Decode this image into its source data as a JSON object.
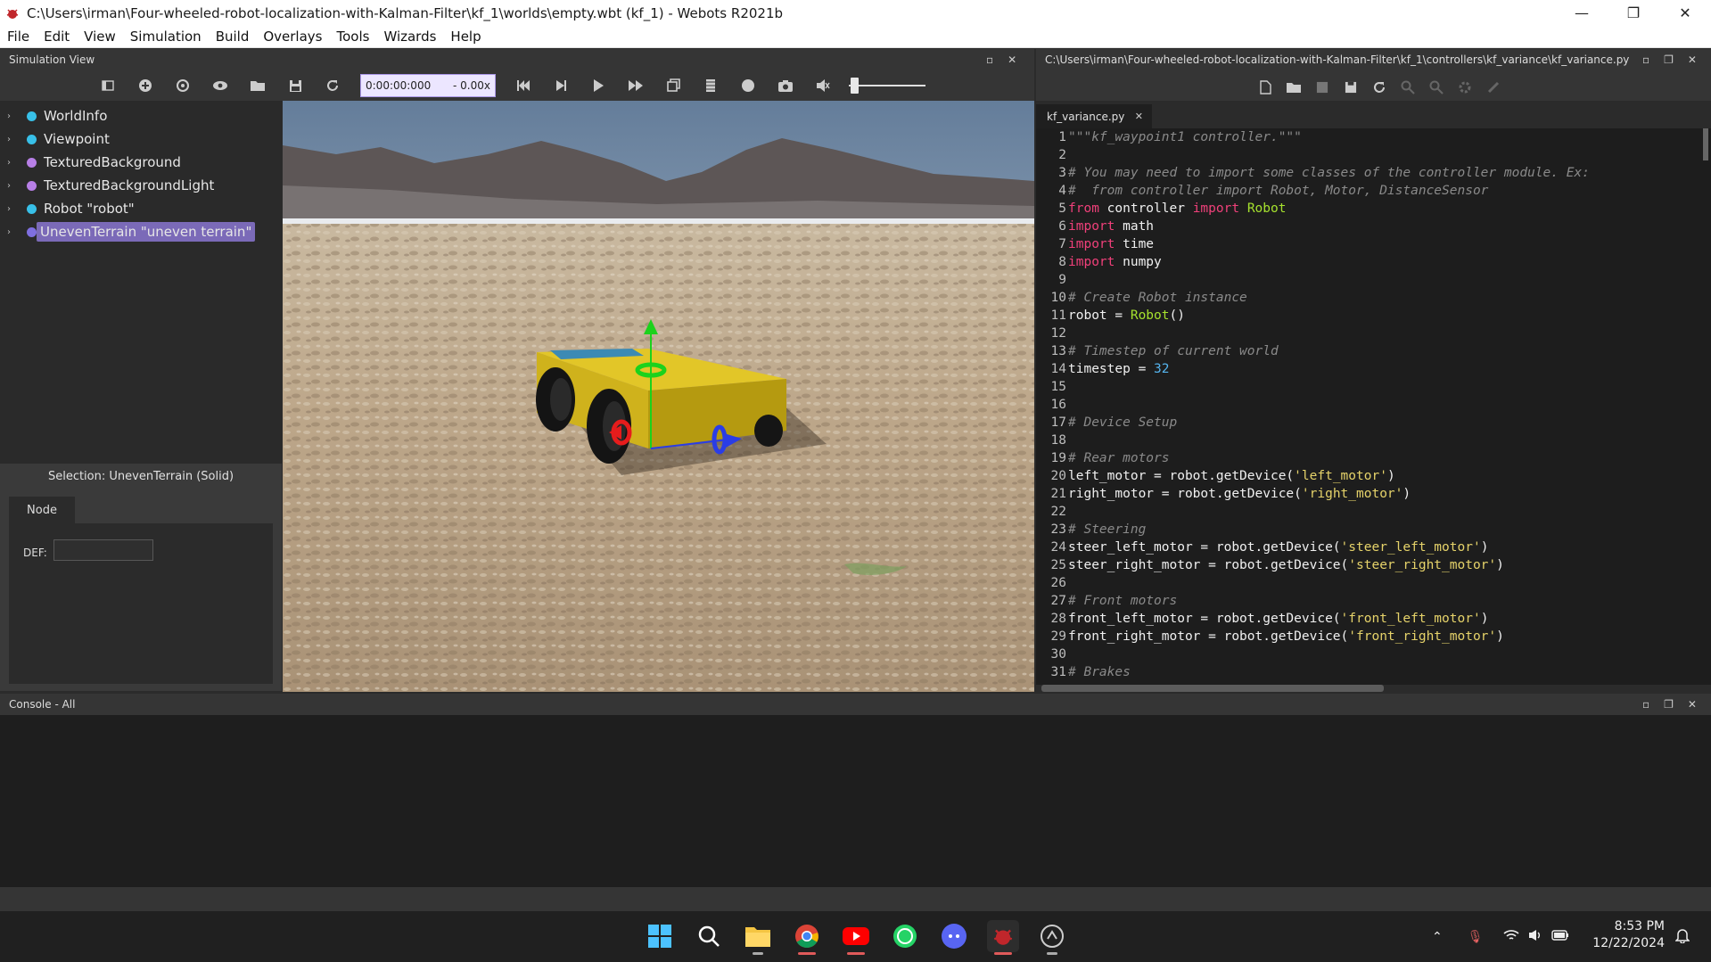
{
  "window": {
    "title": "C:\\Users\\irman\\Four-wheeled-robot-localization-with-Kalman-Filter\\kf_1\\worlds\\empty.wbt (kf_1) - Webots R2021b",
    "controls": [
      "—",
      "❐",
      "✕"
    ]
  },
  "menu": [
    "File",
    "Edit",
    "View",
    "Simulation",
    "Build",
    "Overlays",
    "Tools",
    "Wizards",
    "Help"
  ],
  "simulation_view": {
    "title": "Simulation View",
    "time": "0:00:00:000",
    "speed": "- 0.00x"
  },
  "scene_tree": [
    {
      "label": "WorldInfo",
      "color": "#38c0e8"
    },
    {
      "label": "Viewpoint",
      "color": "#38c0e8"
    },
    {
      "label": "TexturedBackground",
      "color": "#b77fe6"
    },
    {
      "label": "TexturedBackgroundLight",
      "color": "#b77fe6"
    },
    {
      "label": "Robot \"robot\"",
      "color": "#38c0e8"
    },
    {
      "label": "UnevenTerrain \"uneven terrain\"",
      "color": "#7f6fe0"
    }
  ],
  "selection": {
    "label": "Selection: UnevenTerrain (Solid)",
    "tab": "Node",
    "def_label": "DEF:",
    "def_value": ""
  },
  "editor": {
    "path": "C:\\Users\\irman\\Four-wheeled-robot-localization-with-Kalman-Filter\\kf_1\\controllers\\kf_variance\\kf_variance.py",
    "tab": "kf_variance.py",
    "tab_close": "✕",
    "lines": [
      "\"\"\"kf_waypoint1 controller.\"\"\"",
      "",
      "# You may need to import some classes of the controller module. Ex:",
      "#  from controller import Robot, Motor, DistanceSensor",
      "from controller import Robot",
      "import math",
      "import time",
      "import numpy",
      "",
      "# Create Robot instance",
      "robot = Robot()",
      "",
      "# Timestep of current world",
      "timestep = 32",
      "",
      "",
      "# Device Setup",
      "",
      "# Rear motors",
      "left_motor = robot.getDevice('left_motor')",
      "right_motor = robot.getDevice('right_motor')",
      "",
      "# Steering",
      "steer_left_motor = robot.getDevice('steer_left_motor')",
      "steer_right_motor = robot.getDevice('steer_right_motor')",
      "",
      "# Front motors",
      "front_left_motor = robot.getDevice('front_left_motor')",
      "front_right_motor = robot.getDevice('front_right_motor')",
      "",
      "# Brakes"
    ]
  },
  "console": {
    "title": "Console - All"
  },
  "taskbar": {
    "apps": [
      "windows-start",
      "search",
      "file-explorer",
      "chrome",
      "youtube",
      "whatsapp",
      "discord",
      "webots",
      "other-app"
    ],
    "time": "8:53 PM",
    "date": "12/22/2024"
  },
  "colors": {
    "keyword": "#f0407a",
    "comment": "#8a8a8a",
    "string": "#e6d36a",
    "number": "#55b4ee",
    "class": "#a6e22e",
    "selection": "#7b6ab8"
  }
}
